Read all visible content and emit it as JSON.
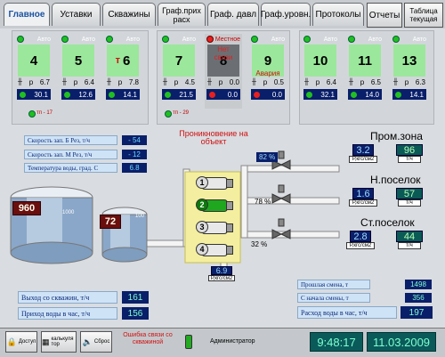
{
  "tabs": [
    {
      "label": "Главное",
      "active": true
    },
    {
      "label": "Уставки"
    },
    {
      "label": "Скважины"
    },
    {
      "label": "Граф.прих расх"
    },
    {
      "label": "Граф. давл"
    },
    {
      "label": "Граф.уровн."
    },
    {
      "label": "Протоколы"
    }
  ],
  "reports_label": "Отчеты",
  "table_label": "Таблица текущая",
  "wells": [
    {
      "num": "4",
      "mode": "Авто",
      "p": "6.7",
      "flow": "30.1",
      "status": "ok"
    },
    {
      "num": "5",
      "mode": "Авто",
      "p": "6.4",
      "flow": "12.6",
      "status": "ok"
    },
    {
      "num": "6",
      "mode": "Авто",
      "prefix": "т",
      "p": "7.8",
      "flow": "14.1",
      "status": "ok"
    },
    {
      "num": "7",
      "mode": "Авто",
      "p": "4.5",
      "flow": "21.5",
      "status": "ok"
    },
    {
      "num": "8",
      "mode": "Местное",
      "alert": "Нет связи",
      "p": "0.0",
      "flow": "0.0",
      "status": "nolink"
    },
    {
      "num": "9",
      "mode": "Авто",
      "alert": "Авария",
      "p": "0.5",
      "flow": "0.0",
      "status": "alarm"
    },
    {
      "num": "10",
      "mode": "Авто",
      "p": "6.4",
      "flow": "32.1",
      "status": "ok"
    },
    {
      "num": "11",
      "mode": "Авто",
      "p": "6.5",
      "flow": "14.0",
      "status": "ok"
    },
    {
      "num": "13",
      "mode": "Авто",
      "p": "6.3",
      "flow": "14.1",
      "status": "ok"
    }
  ],
  "p_letter": "р",
  "tp_labels": [
    "тп - 17",
    "тп - 29"
  ],
  "speed_b_label": "Скорость зап. Б Рез, т/ч",
  "speed_b_value": "- 54",
  "speed_m_label": "Скорость зап. М Рез, т/ч",
  "speed_m_value": "- 12",
  "water_temp_label": "Температура воды, град. С",
  "water_temp_value": "6.8",
  "intrusion_label": "Проникновение на объект",
  "tank_big_value": "960",
  "tank_big_cap": "1000",
  "tank_small_value": "72",
  "tank_small_cap": "100",
  "pumps": [
    "1",
    "2",
    "3",
    "4"
  ],
  "pump_pressure": "6.9",
  "pump_pressure_unit": "Р,кгс/см2",
  "valve_pcts": [
    "82 %",
    "78 %",
    "32 %"
  ],
  "zones": [
    {
      "name": "Пром.зона",
      "p": "3.2",
      "p_unit": "Р,кгс/см2",
      "flow": "96",
      "flow_unit": "т/ч"
    },
    {
      "name": "Н.поселок",
      "p": "1.6",
      "p_unit": "Р,кгс/см2",
      "flow": "57",
      "flow_unit": "т/ч"
    },
    {
      "name": "Ст.поселок",
      "p": "2.8",
      "p_unit": "Р,кгс/см2",
      "flow": "44",
      "flow_unit": "т/ч"
    }
  ],
  "output_label": "Выход со скважин, т/ч",
  "output_value": "161",
  "inflow_label": "Приход воды в час, т/ч",
  "inflow_value": "156",
  "last_shift_label": "Прошлая смена, т",
  "last_shift_value": "1498",
  "shift_start_label": "С начала смены, т",
  "shift_start_value": "356",
  "consumption_label": "Расход воды в час, т/ч",
  "consumption_value": "197",
  "bottom": {
    "access": "Доступ",
    "calculator": "калькуля тор",
    "reset": "Сброс",
    "error": "Ошибка связи со скважиной",
    "user": "Администратор",
    "time": "9:48:17",
    "date": "11.03.2009"
  },
  "colors": {
    "running_pump": "#1fa81f",
    "stopped_pump": "#e8e8e8",
    "tank": "#ffffff",
    "pipe": "#f2f2f2"
  }
}
